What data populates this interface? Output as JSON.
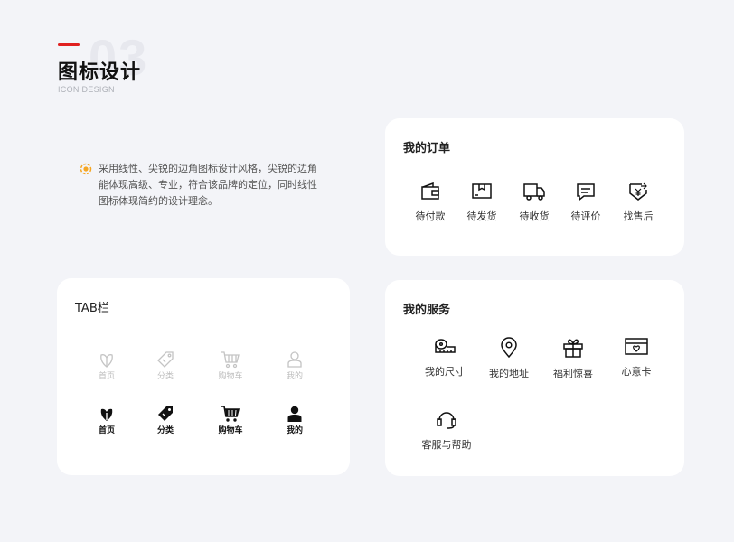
{
  "header": {
    "section_number": "03",
    "title": "图标设计",
    "subtitle": "ICON DESIGN"
  },
  "description": "采用线性、尖锐的边角图标设计风格，尖锐的边角能体现高级、专业，符合该品牌的定位，同时线性图标体现简约的设计理念。",
  "orders": {
    "title": "我的订单",
    "items": [
      {
        "label": "待付款",
        "icon": "wallet-icon"
      },
      {
        "label": "待发货",
        "icon": "package-icon"
      },
      {
        "label": "待收货",
        "icon": "delivery-truck-icon"
      },
      {
        "label": "待评价",
        "icon": "comment-icon"
      },
      {
        "label": "找售后",
        "icon": "refund-shield-icon"
      }
    ]
  },
  "services": {
    "title": "我的服务",
    "items": [
      {
        "label": "我的尺寸",
        "icon": "tape-measure-icon"
      },
      {
        "label": "我的地址",
        "icon": "location-pin-icon"
      },
      {
        "label": "福利惊喜",
        "icon": "gift-icon"
      },
      {
        "label": "心意卡",
        "icon": "heart-card-icon"
      },
      {
        "label": "客服与帮助",
        "icon": "headset-icon"
      }
    ]
  },
  "tabbar": {
    "title": "TAB栏",
    "inactive": [
      {
        "label": "首页",
        "icon": "home-leaf-outline-icon"
      },
      {
        "label": "分类",
        "icon": "tag-outline-icon"
      },
      {
        "label": "购物车",
        "icon": "cart-outline-icon"
      },
      {
        "label": "我的",
        "icon": "user-outline-icon"
      }
    ],
    "active": [
      {
        "label": "首页",
        "icon": "home-leaf-filled-icon"
      },
      {
        "label": "分类",
        "icon": "tag-filled-icon"
      },
      {
        "label": "购物车",
        "icon": "cart-filled-icon"
      },
      {
        "label": "我的",
        "icon": "user-filled-icon"
      }
    ]
  },
  "colors": {
    "accent_red": "#e02020",
    "bullet_orange": "#f5a623",
    "background": "#f3f4f8",
    "inactive_gray": "#bdbdbd"
  }
}
